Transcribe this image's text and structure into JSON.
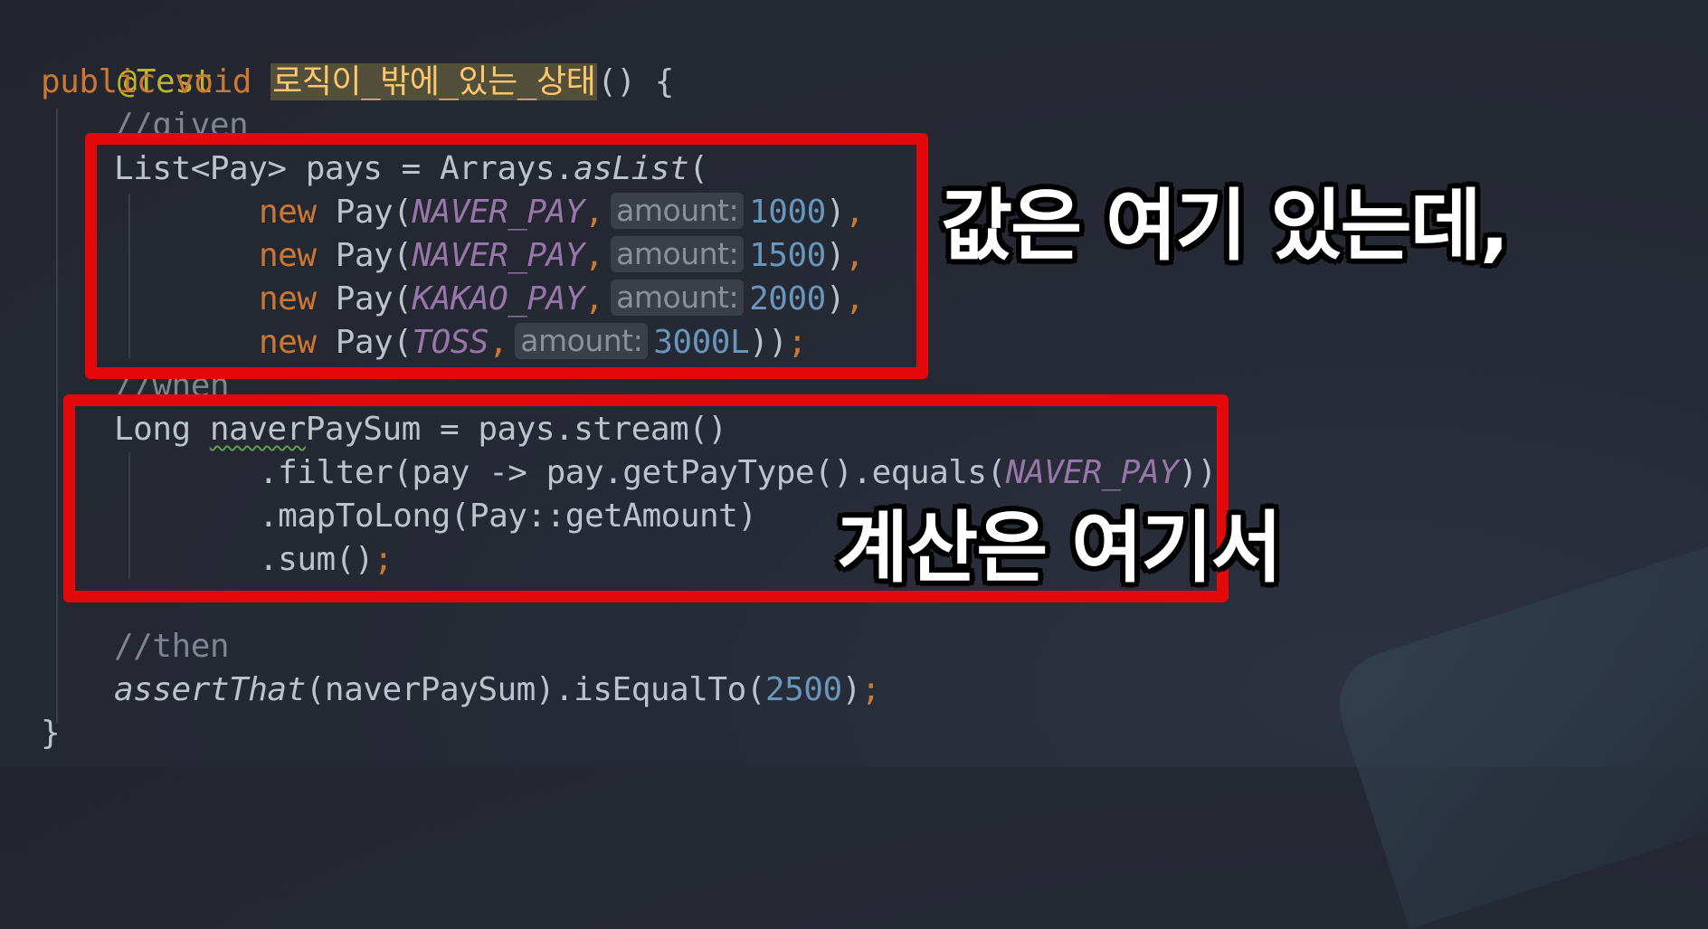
{
  "code": {
    "annotation": "@Test",
    "signature": {
      "modifiers": "public void ",
      "method_name": "로직이_밖에_있는_상태",
      "tail": "() {"
    },
    "comment_given": "//given",
    "list_decl": {
      "prefix": "List<Pay> pays = Arrays.",
      "method": "asList",
      "open": "("
    },
    "pays": [
      {
        "keyword": "new",
        "ctor": " Pay(",
        "type": "NAVER_PAY",
        "hint": "amount:",
        "amount": "1000",
        "close": ")",
        "end": ","
      },
      {
        "keyword": "new",
        "ctor": " Pay(",
        "type": "NAVER_PAY",
        "hint": "amount:",
        "amount": "1500",
        "close": ")",
        "end": ","
      },
      {
        "keyword": "new",
        "ctor": " Pay(",
        "type": "KAKAO_PAY",
        "hint": "amount:",
        "amount": "2000",
        "close": ")",
        "end": ","
      },
      {
        "keyword": "new",
        "ctor": " Pay(",
        "type": "TOSS",
        "hint": "amount:",
        "amount": "3000L",
        "close": "))",
        "end": ";"
      }
    ],
    "comment_when": "//when",
    "sum_decl": {
      "type": "Long ",
      "var_warn": "naver",
      "var_rest": "PaySum",
      "rest": " = pays.stream()"
    },
    "filter_line": {
      "prefix": ".filter(pay -> pay.getPayType().equals(",
      "const": "NAVER_PAY",
      "suffix": "))"
    },
    "map_line": ".mapToLong(Pay::getAmount)",
    "sum_line": {
      "text": ".sum()",
      "end": ";"
    },
    "comment_then": "//then",
    "assert_line": {
      "method": "assertThat",
      "middle": "(naverPaySum).isEqualTo(",
      "number": "2500",
      "close": ")",
      "end": ";"
    },
    "closing_brace": "}"
  },
  "overlays": {
    "caption_values": "값은 여기 있는데,",
    "caption_calc": "계산은 여기서"
  },
  "colors": {
    "highlight_box": "#e3090b",
    "keyword": "#cc7832",
    "constant": "#9876aa",
    "number": "#6897bb",
    "comment": "#7f8590",
    "annotation": "#bbb529"
  }
}
